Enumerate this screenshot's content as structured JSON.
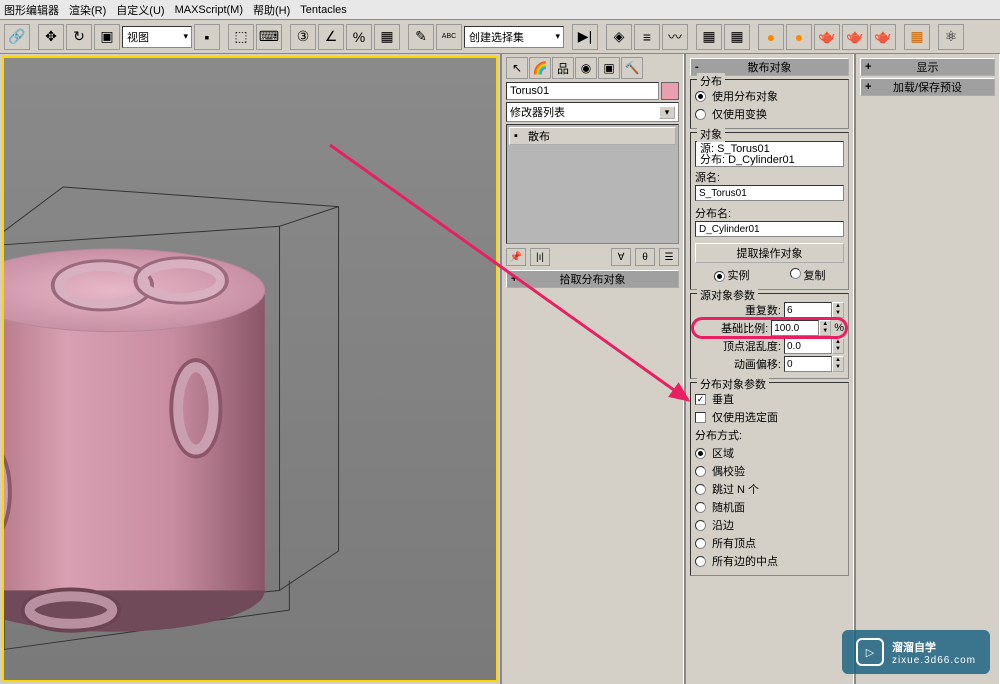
{
  "menubar": [
    "图形编辑器",
    "渲染(R)",
    "自定义(U)",
    "MAXScript(M)",
    "帮助(H)",
    "Tentacles"
  ],
  "toolbar": {
    "view_mode": "视图",
    "select_set": "创建选择集"
  },
  "modify_panel": {
    "object_name": "Torus01",
    "modifier_list_label": "修改器列表",
    "stack_item": "散布"
  },
  "rollouts": {
    "pick_distribution": {
      "header": "拾取分布对象"
    },
    "scatter_objects": {
      "header": "散布对象",
      "distribution_group": "分布",
      "use_distribution_obj": "使用分布对象",
      "use_transforms_only": "仅使用变换",
      "objects_group": "对象",
      "source_line": "源: S_Torus01",
      "dist_line": "分布: D_Cylinder01",
      "source_name_label": "源名:",
      "source_name_val": "S_Torus01",
      "dist_name_label": "分布名:",
      "dist_name_val": "D_Cylinder01",
      "extract_op_obj": "提取操作对象",
      "instance": "实例",
      "copy": "复制",
      "source_params_group": "源对象参数",
      "duplicates_label": "重复数:",
      "duplicates_val": "6",
      "base_scale_label": "基础比例:",
      "base_scale_val": "100.0",
      "vertex_chaos_label": "顶点混乱度:",
      "vertex_chaos_val": "0.0",
      "anim_offset_label": "动画偏移:",
      "anim_offset_val": "0",
      "dist_params_group": "分布对象参数",
      "perpendicular": "垂直",
      "use_selected_faces": "仅使用选定面",
      "dist_method_label": "分布方式:",
      "area": "区域",
      "even_check": "偶校验",
      "skip_n": "跳过 N 个",
      "random_faces": "随机面",
      "along_edges": "沿边",
      "all_vertices": "所有顶点",
      "all_edge_centers": "所有边的中点"
    },
    "display": {
      "header": "显示"
    },
    "load_save": {
      "header": "加载/保存预设"
    }
  },
  "watermark": {
    "text": "溜溜自学",
    "sub": "zixue.3d66.com"
  }
}
